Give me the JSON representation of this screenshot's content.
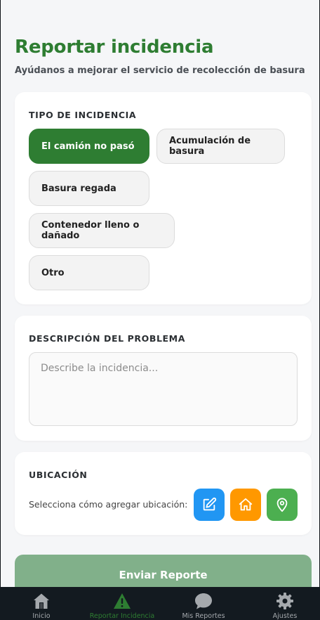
{
  "header": {
    "title": "Reportar incidencia",
    "subtitle": "Ayúdanos a mejorar el servicio de recolección de basura"
  },
  "incident_type": {
    "label": "TIPO DE INCIDENCIA",
    "options": [
      {
        "label": "El camión no pasó",
        "selected": true
      },
      {
        "label": "Acumulación de basura",
        "selected": false
      },
      {
        "label": "Basura regada",
        "selected": false
      },
      {
        "label": "Contenedor lleno o dañado",
        "selected": false
      },
      {
        "label": "Otro",
        "selected": false
      }
    ]
  },
  "description": {
    "label": "DESCRIPCIÓN DEL PROBLEMA",
    "placeholder": "Describe la incidencia...",
    "value": ""
  },
  "location": {
    "label": "UBICACIÓN",
    "prompt": "Selecciona cómo agregar ubicación:",
    "buttons": [
      {
        "icon": "edit-icon",
        "color": "#2196f3"
      },
      {
        "icon": "home-icon",
        "color": "#ff9800"
      },
      {
        "icon": "location-pin-icon",
        "color": "#4caf50"
      }
    ]
  },
  "submit": {
    "label": "Enviar Reporte"
  },
  "nav": {
    "items": [
      {
        "label": "Inicio",
        "icon": "home-icon",
        "active": false
      },
      {
        "label": "Reportar Incidencia",
        "icon": "warning-icon",
        "active": true
      },
      {
        "label": "Mis Reportes",
        "icon": "chat-bubble-icon",
        "active": false
      },
      {
        "label": "Ajustes",
        "icon": "gear-icon",
        "active": false
      }
    ]
  },
  "colors": {
    "primary": "#2e7d32",
    "submit_disabled": "#81b08a",
    "nav_background": "#131a20"
  }
}
